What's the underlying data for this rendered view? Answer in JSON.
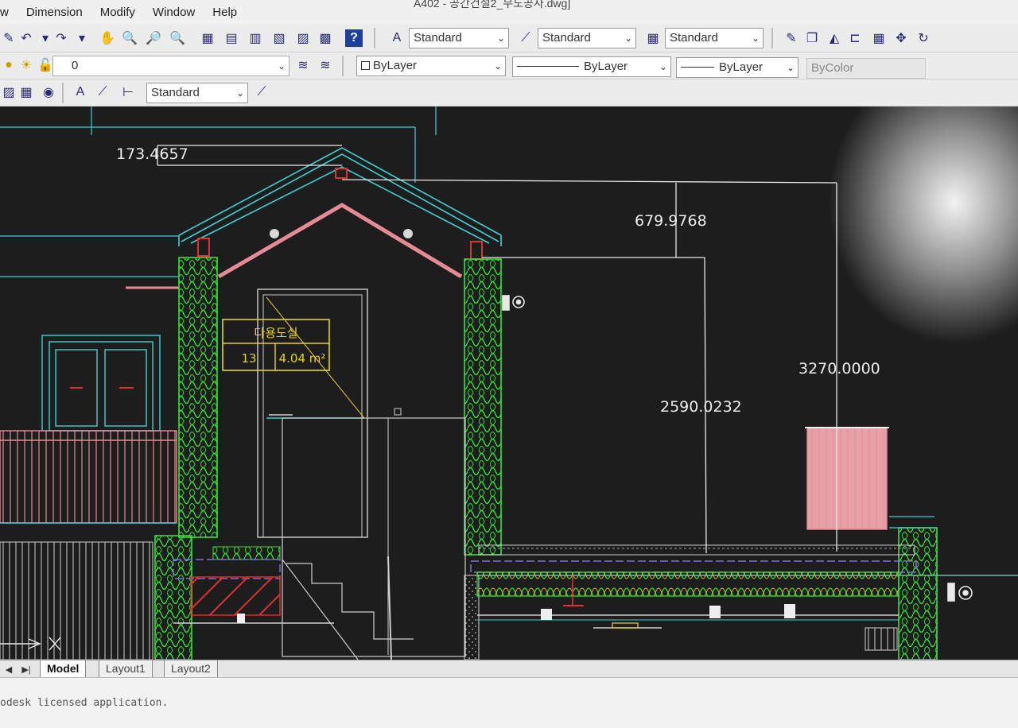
{
  "window": {
    "title_fragment": "A402 - 공간건설2_무도공사.dwg]"
  },
  "menu": [
    "w",
    "Dimension",
    "Modify",
    "Window",
    "Help"
  ],
  "toolbar": {
    "text_style": "Standard",
    "dim_style": "Standard",
    "table_style": "Standard",
    "layer_current": "0",
    "color": "ByLayer",
    "linetype": "ByLayer",
    "lineweight": "ByLayer",
    "plot_style": "ByColor",
    "multileader_style": "Standard"
  },
  "drawing": {
    "dimensions": [
      "173.4657",
      "679.9768",
      "3270.0000",
      "2590.0232"
    ],
    "room_tag": {
      "name": "다용도실",
      "number": "13",
      "area": "4.04 m²"
    },
    "colors": {
      "background": "#1c1d1c",
      "cyan": "#3fd0d0",
      "green": "#38e03a",
      "pink": "#e58a96",
      "yellow": "#e6d21a",
      "red": "#e03030",
      "white": "#e8e8e8"
    }
  },
  "tabs": {
    "items": [
      "Model",
      "Layout1",
      "Layout2"
    ],
    "active": "Model"
  },
  "command": {
    "history": "odesk licensed application."
  }
}
